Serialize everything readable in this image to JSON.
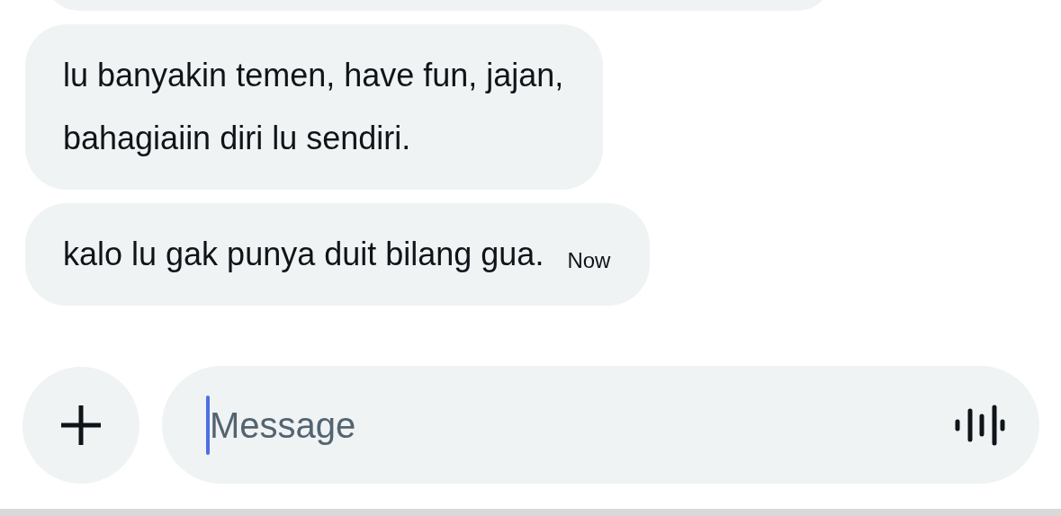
{
  "messages": [
    {
      "text": "lu banyakin temen, have fun, jajan,\nbahagiaiin diri lu sendiri."
    },
    {
      "text": "kalo lu gak punya duit bilang gua.",
      "time": "Now"
    }
  ],
  "composer": {
    "placeholder": "Message",
    "focused": true
  }
}
